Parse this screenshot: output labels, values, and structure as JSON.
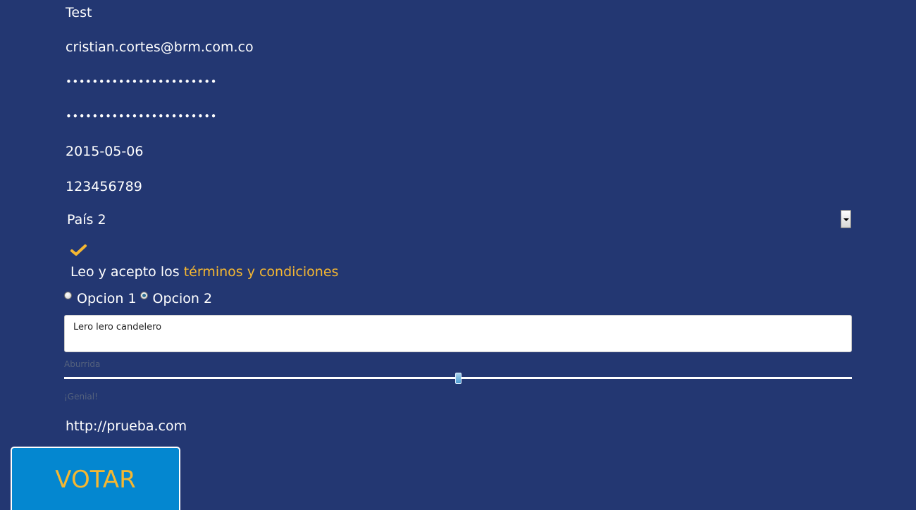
{
  "form": {
    "name": "Test",
    "email": "cristian.cortes@brm.com.co",
    "password": "•••••••••••••••••••••••",
    "password_confirm": "•••••••••••••••••••••••",
    "date": "2015-05-06",
    "phone": "123456789",
    "country": "País 2",
    "terms_prefix": "Leo y acepto los ",
    "terms_link": "términos y condiciones",
    "terms_checked": true,
    "radio_option_1": "Opcion 1",
    "radio_option_2": "Opcion 2",
    "radio_selected": "Opcion 2",
    "comment": "Lero lero candelero",
    "slider_min_label": "Aburrida",
    "slider_max_label": "¡Genial!",
    "slider_value_fraction": 0.5,
    "url": "http://prueba.com",
    "submit_label": "VOTAR"
  },
  "icons": {
    "terms_check": "check-icon",
    "select_arrow": "chevron-down-icon"
  },
  "colors": {
    "background": "#233772",
    "accent": "#f5b731",
    "button": "#0487d0",
    "text": "#ffffff"
  }
}
